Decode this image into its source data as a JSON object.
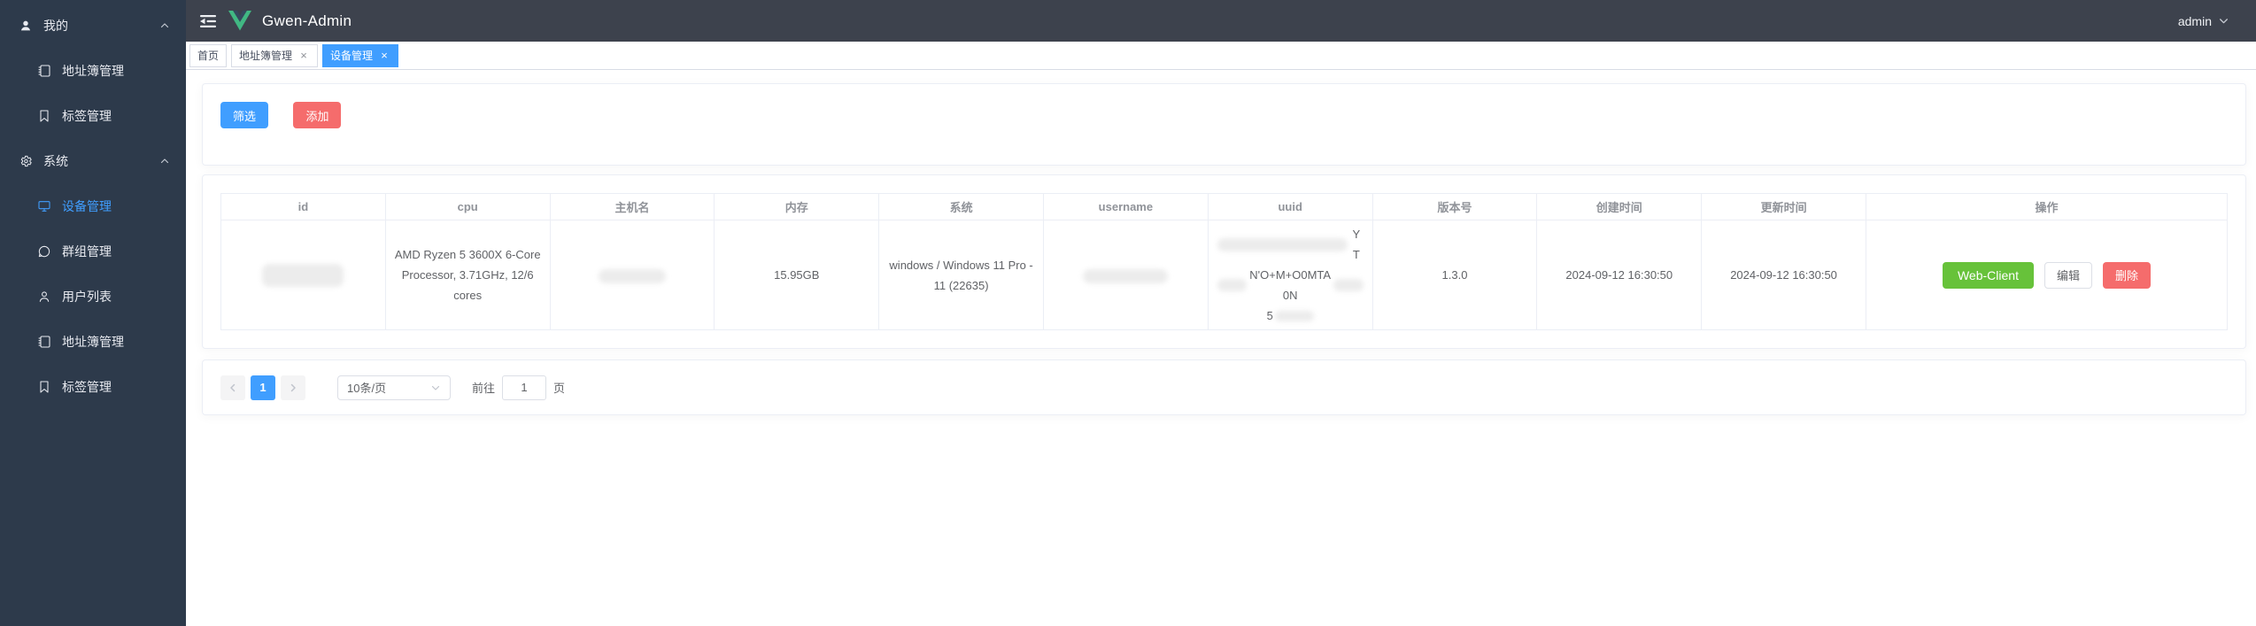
{
  "colors": {
    "primary": "#409eff",
    "danger": "#f56c6c",
    "success": "#67c23a",
    "sidebar_bg": "#2d3a4b",
    "navbar_bg": "#3d424d"
  },
  "header": {
    "title": "Gwen-Admin",
    "user": "admin"
  },
  "sidebar": {
    "groups": [
      {
        "label": "我的",
        "icon": "user-icon",
        "expanded": true,
        "items": [
          {
            "label": "地址簿管理",
            "icon": "address-book-icon",
            "active": false
          },
          {
            "label": "标签管理",
            "icon": "bookmark-icon",
            "active": false
          }
        ]
      },
      {
        "label": "系统",
        "icon": "gear-icon",
        "expanded": true,
        "items": [
          {
            "label": "设备管理",
            "icon": "monitor-icon",
            "active": true
          },
          {
            "label": "群组管理",
            "icon": "chat-icon",
            "active": false
          },
          {
            "label": "用户列表",
            "icon": "user-list-icon",
            "active": false
          },
          {
            "label": "地址簿管理",
            "icon": "address-book-icon",
            "active": false
          },
          {
            "label": "标签管理",
            "icon": "bookmark-icon",
            "active": false
          }
        ]
      }
    ]
  },
  "tabs": [
    {
      "label": "首页",
      "closable": false,
      "active": false
    },
    {
      "label": "地址簿管理",
      "closable": true,
      "active": false
    },
    {
      "label": "设备管理",
      "closable": true,
      "active": true
    }
  ],
  "toolbar": {
    "filter": "筛选",
    "add": "添加"
  },
  "table": {
    "columns": [
      "id",
      "cpu",
      "主机名",
      "内存",
      "系统",
      "username",
      "uuid",
      "版本号",
      "创建时间",
      "更新时间",
      "操作"
    ],
    "row": {
      "id_redacted": true,
      "cpu": "AMD Ryzen 5 3600X 6-Core Processor, 3.71GHz, 12/6 cores",
      "hostname_redacted": true,
      "memory": "15.95GB",
      "system": "windows / Windows 11 Pro - 11 (22635)",
      "username_redacted": true,
      "uuid_redacted": true,
      "uuid_visible": {
        "line1_end": "YT",
        "line2_mid": "N'O+M+O0MTA0N",
        "line3_start": "5"
      },
      "version": "1.3.0",
      "created_at": "2024-09-12 16:30:50",
      "updated_at": "2024-09-12 16:30:50",
      "actions": {
        "web_client": "Web-Client",
        "edit": "编辑",
        "delete": "删除"
      }
    }
  },
  "pagination": {
    "current_page": "1",
    "page_size_option": "10条/页",
    "goto_label": "前往",
    "goto_value": "1",
    "page_unit": "页"
  }
}
